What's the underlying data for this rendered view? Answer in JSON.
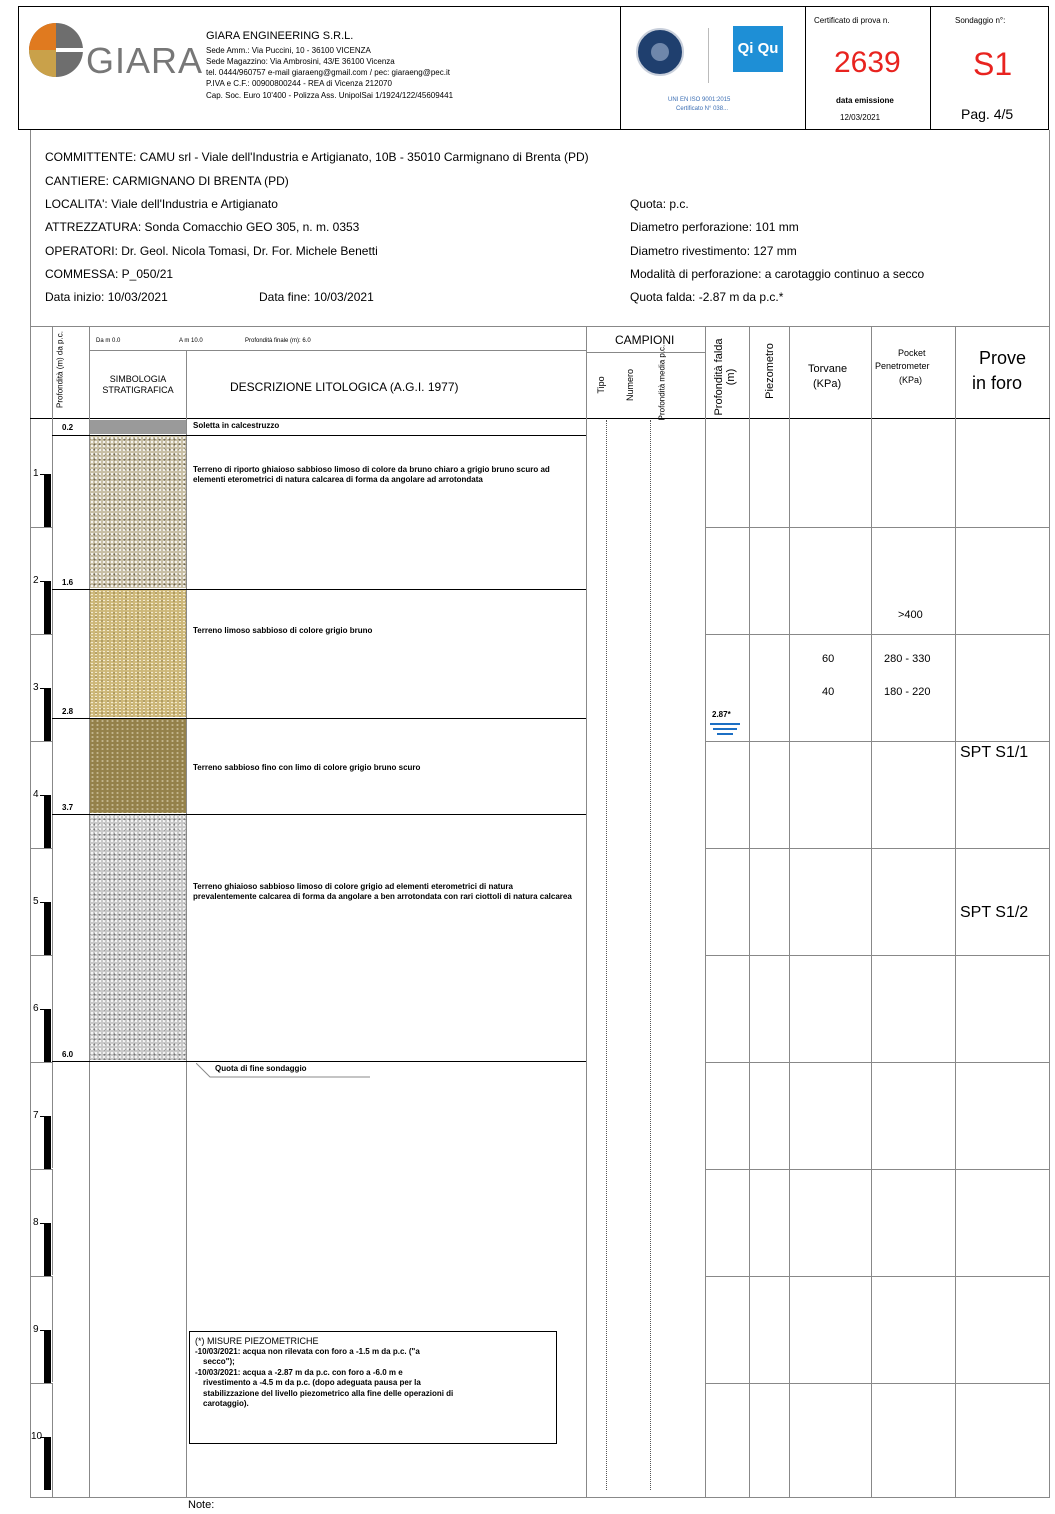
{
  "company": {
    "logo_text": "GIARA",
    "name": "GIARA ENGINEERING S.R.L.",
    "lines": [
      "Sede Amm.: Via Puccini, 10 - 36100 VICENZA",
      "Sede Magazzino: Via Ambrosini, 43/E 36100 Vicenza",
      "tel. 0444/960757 e-mail giaraeng@gmail.com / pec: giaraeng@pec.it",
      "P.IVA e C.F.: 00900800244 - REA di Vicenza 212070",
      "Cap. Soc. Euro 10'400 - Polizza Ass. UnipolSai 1/1924/122/45609441"
    ]
  },
  "cert": {
    "accredia": "ACCREDIA",
    "qiqu": "Qi Qu",
    "iso": "UNI EN ISO 9001:2015",
    "iso_cert": "Certificato N° 038...",
    "label": "Certificato di prova n.",
    "number": "2639",
    "emission_label": "data emissione",
    "emission_date": "12/03/2021",
    "sondaggio_label": "Sondaggio n°:",
    "sondaggio": "S1",
    "page": "Pag. 4/5"
  },
  "info": {
    "committente": "COMMITTENTE: CAMU srl - Viale dell'Industria e Artigianato, 10B - 35010 Carmignano di Brenta (PD)",
    "cantiere": "CANTIERE: CARMIGNANO DI BRENTA (PD)",
    "localita": "LOCALITA': Viale dell'Industria e Artigianato",
    "attrezzatura": "ATTREZZATURA: Sonda Comacchio GEO 305, n. m. 0353",
    "operatori": "OPERATORI: Dr. Geol. Nicola Tomasi, Dr. For. Michele Benetti",
    "commessa": "COMMESSA: P_050/21",
    "data_inizio": "Data inizio: 10/03/2021",
    "data_fine": "Data fine: 10/03/2021",
    "quota": "Quota: p.c.",
    "diam_perf": "Diametro perforazione: 101 mm",
    "diam_riv": "Diametro rivestimento: 127 mm",
    "modalita": "Modalità di perforazione: a carotaggio continuo a secco",
    "quota_falda": "Quota falda: -2.87 m da p.c.*"
  },
  "table_header": {
    "depth": "Profondità (m) da p.c.",
    "da": "Da m 0.0",
    "a": "A m 10.0",
    "prof_finale": "Profondità finale (m): 6.0",
    "simbologia": "SIMBOLOGIA STRATIGRAFICA",
    "descrizione": "DESCRIZIONE LITOLOGICA (A.G.I. 1977)",
    "campioni": "CAMPIONI",
    "tipo": "Tipo",
    "numero": "Numero",
    "prof_media": "Profondità media p.c.",
    "prof_falda": "Profondità falda (m)",
    "piezometro": "Piezometro",
    "torvane": "Torvane",
    "torvane_unit": "(KPa)",
    "pocket1": "Pocket",
    "pocket2": "Penetrometer",
    "pocket_unit": "(KPa)",
    "prove1": "Prove",
    "prove2": "in foro"
  },
  "scale_ticks": [
    "1",
    "2",
    "3",
    "4",
    "5",
    "6",
    "7",
    "8",
    "9",
    "10"
  ],
  "layers": [
    {
      "depth_end": "0.2",
      "desc": "Soletta in calcestruzzo"
    },
    {
      "depth_end": "1.6",
      "desc": "Terreno di riporto ghiaioso sabbioso limoso di colore da bruno chiaro a grigio bruno scuro ad elementi eterometrici di natura calcarea di forma da angolare ad arrotondata"
    },
    {
      "depth_end": "2.8",
      "desc": "Terreno limoso sabbioso di colore grigio bruno"
    },
    {
      "depth_end": "3.7",
      "desc": "Terreno sabbioso fino con limo di colore grigio bruno scuro"
    },
    {
      "depth_end": "6.0",
      "desc": "Terreno ghiaioso sabbioso limoso di colore grigio ad elementi eterometrici di natura prevalentemente calcarea di forma da angolare a ben arrotondata con rari ciottoli di natura calcarea"
    }
  ],
  "fine": "Quota di fine sondaggio",
  "falda_label": "2.87*",
  "tests": {
    "pocket": [
      ">400",
      "280 - 330",
      "180 - 220"
    ],
    "torvane": [
      "60",
      "40"
    ],
    "spt": [
      "SPT S1/1",
      "SPT S1/2"
    ]
  },
  "notes_box": {
    "title": "(*) MISURE PIEZOMETRICHE",
    "l1": "-10/03/2021: acqua non rilevata con foro a -1.5 m da p.c. (\"a",
    "l2": "secco\");",
    "l3": "-10/03/2021: acqua a -2.87 m da p.c. con foro a -6.0 m e",
    "l4": "rivestimento a -4.5 m da p.c. (dopo adeguata pausa per la",
    "l5": "stabilizzazione del livello piezometrico alla fine delle operazioni di",
    "l6": "carotaggio)."
  },
  "note_label": "Note:"
}
